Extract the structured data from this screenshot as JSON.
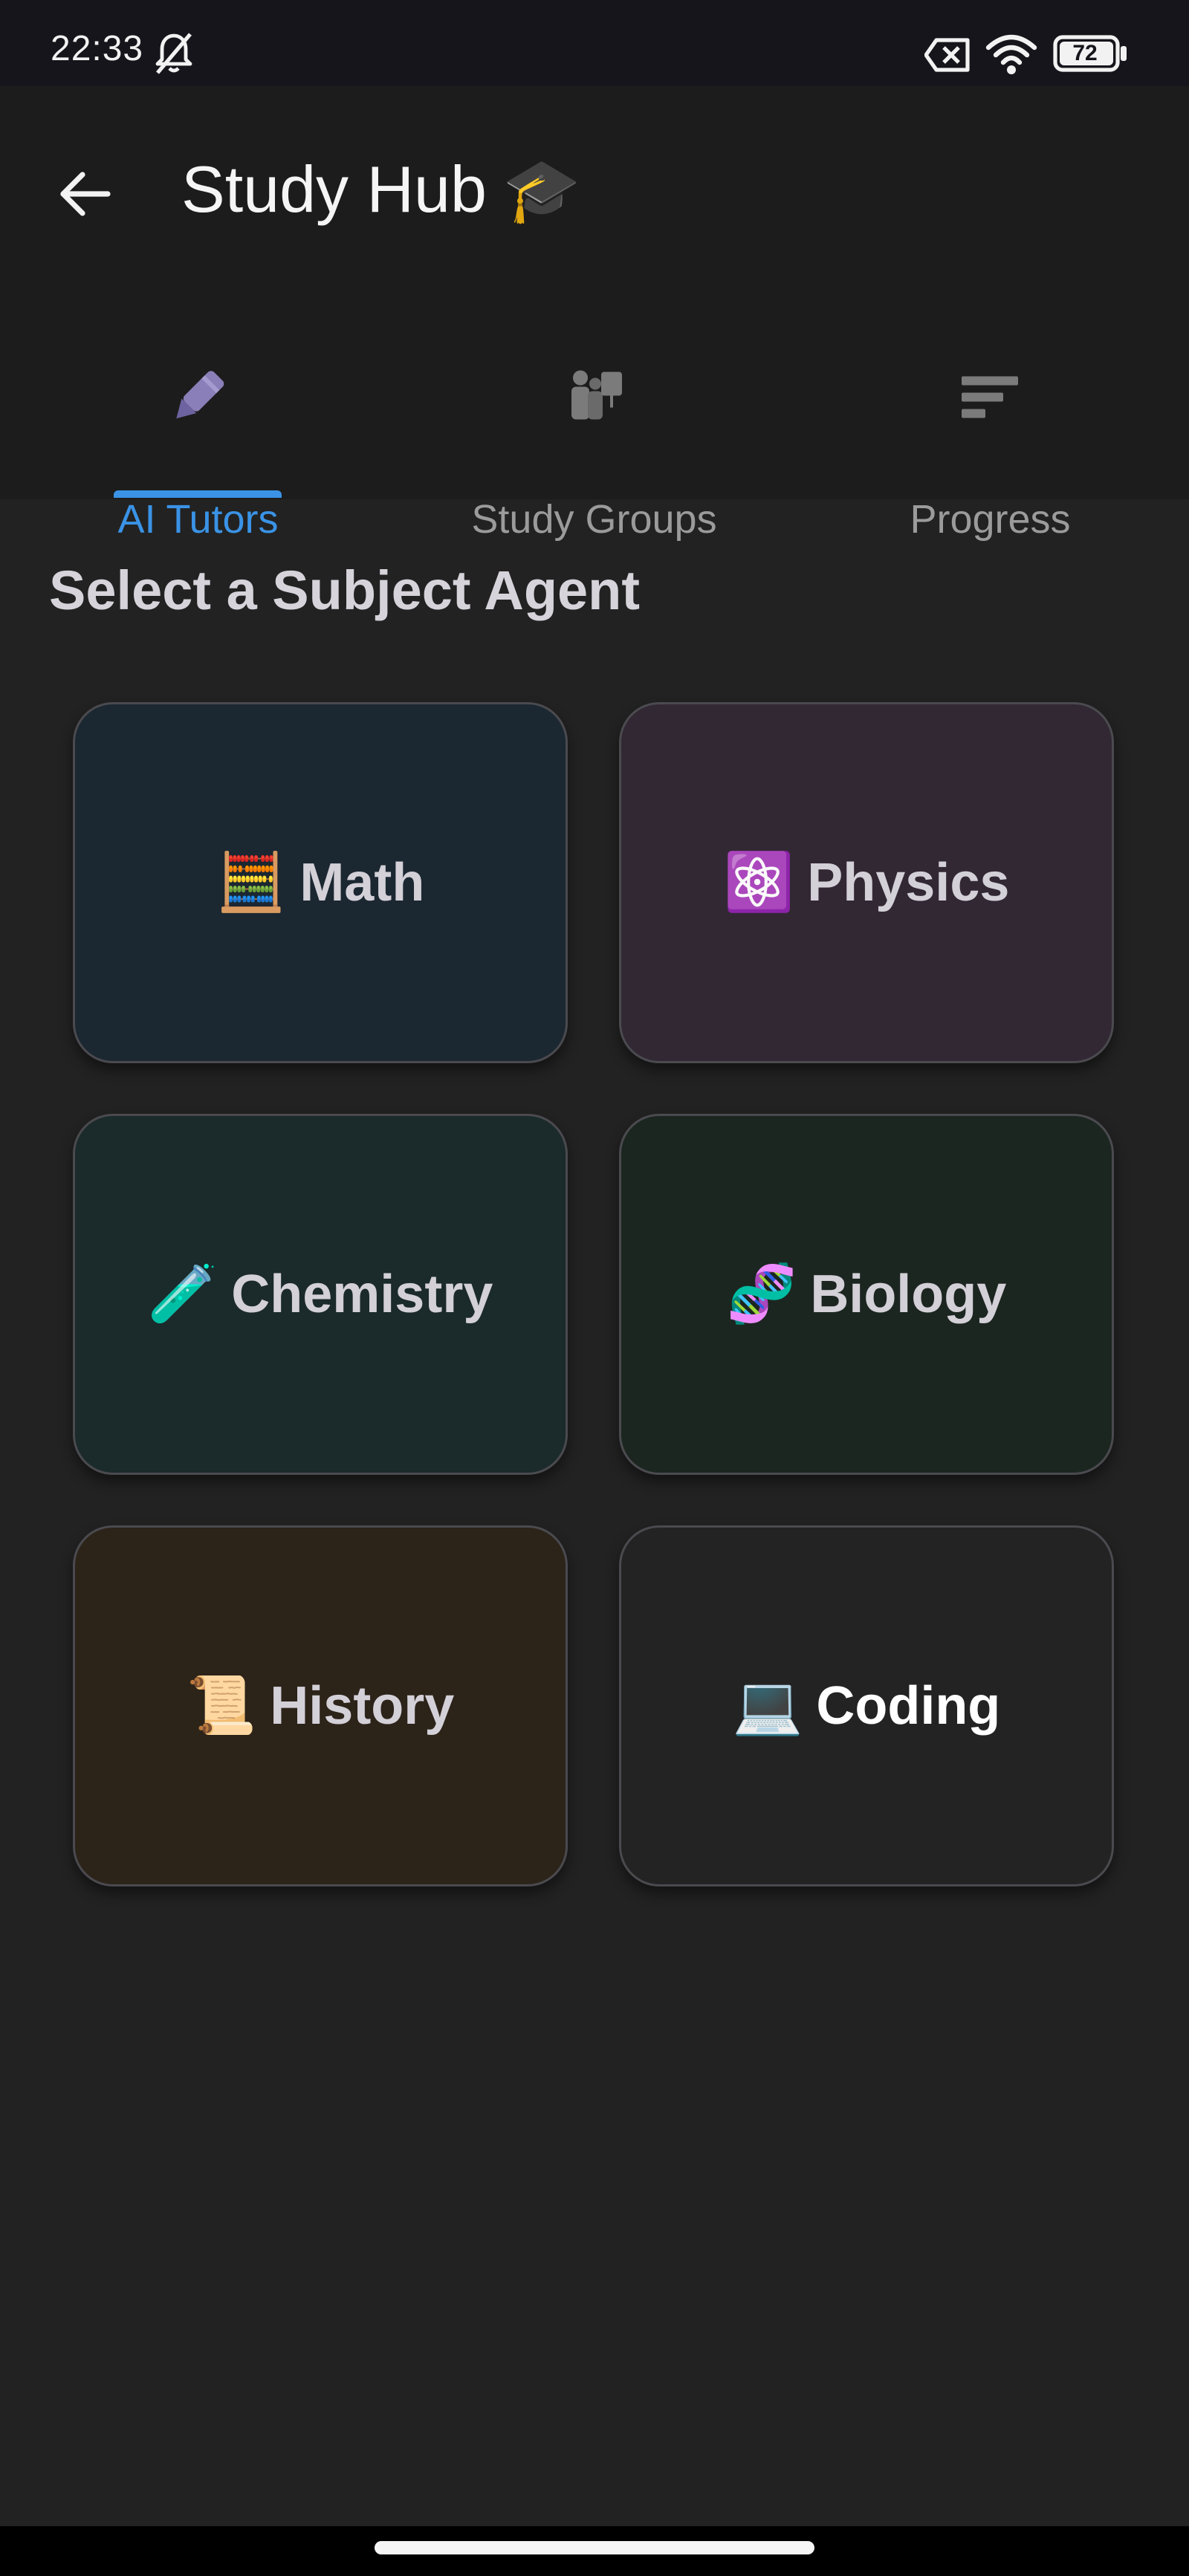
{
  "status_bar": {
    "time": "22:33",
    "battery": "72"
  },
  "header": {
    "title": "Study Hub",
    "title_emoji": "🎓"
  },
  "tabs": [
    {
      "label": "AI Tutors",
      "active": true
    },
    {
      "label": "Study Groups",
      "active": false
    },
    {
      "label": "Progress",
      "active": false
    }
  ],
  "main": {
    "section_title": "Select a Subject Agent",
    "subjects": [
      {
        "emoji": "🧮",
        "label": "Math",
        "color": "#1b2731"
      },
      {
        "emoji": "⚛️",
        "label": "Physics",
        "color": "#322834"
      },
      {
        "emoji": "🧪",
        "label": "Chemistry",
        "color": "#1b2a2b"
      },
      {
        "emoji": "🧬",
        "label": "Biology",
        "color": "#1c2620"
      },
      {
        "emoji": "📜",
        "label": "History",
        "color": "#2c2319"
      },
      {
        "emoji": "💻",
        "label": "Coding",
        "color": "#232323"
      }
    ]
  },
  "colors": {
    "accent": "#3a93e6",
    "background": "#222222",
    "header": "#1c1c1c",
    "status_bar": "#16151b"
  }
}
